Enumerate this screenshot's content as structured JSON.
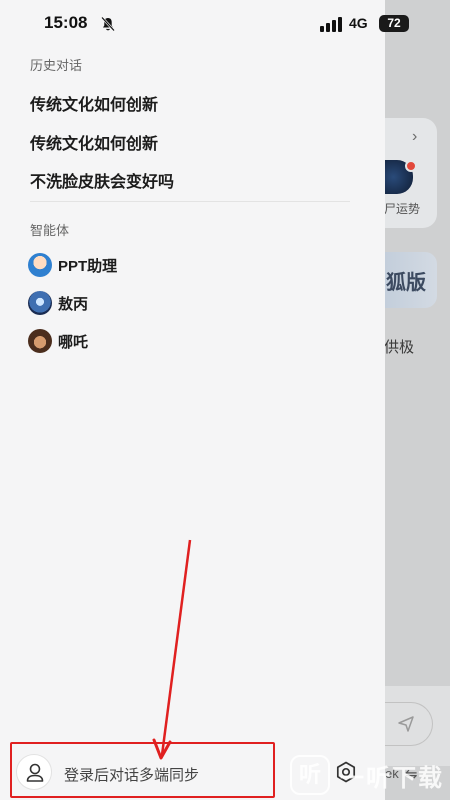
{
  "status_bar": {
    "time": "15:08",
    "network": "4G",
    "battery": "72"
  },
  "background": {
    "chevron": "›",
    "card_text": "尸运势",
    "banner_text": "狐版",
    "line_text": "供极",
    "bottom_text": "ek",
    "switch_glyph": "⇋"
  },
  "drawer": {
    "history_label": "历史对话",
    "history": [
      {
        "title": "传统文化如何创新"
      },
      {
        "title": "传统文化如何创新"
      },
      {
        "title": "不洗脸皮肤会变好吗"
      }
    ],
    "agents_label": "智能体",
    "agents": [
      {
        "name": "PPT助理",
        "avatar": "ppt-assistant-avatar"
      },
      {
        "name": "敖丙",
        "avatar": "aobing-avatar"
      },
      {
        "name": "哪吒",
        "avatar": "nezha-avatar"
      }
    ],
    "login_text": "登录后对话多端同步"
  },
  "annotation": {
    "highlight_color": "#e02020"
  },
  "watermark": {
    "logo": "听",
    "text": "一听下载"
  },
  "colors": {
    "drawer_bg": "#f5f5f6",
    "dim_bg": "#cfd0d1"
  }
}
